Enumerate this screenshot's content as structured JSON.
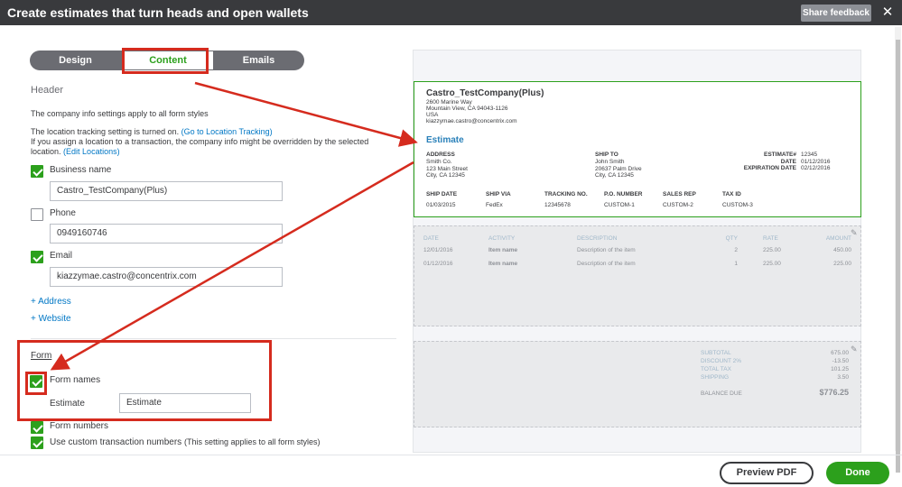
{
  "window": {
    "title": "Create estimates that turn heads and open wallets",
    "share_feedback": "Share feedback",
    "close_glyph": "✕"
  },
  "tabs": [
    "Design",
    "Content",
    "Emails"
  ],
  "header": {
    "title": "Header",
    "info1": "The company info settings apply to all form styles",
    "loc_line": "The location tracking setting is turned on.",
    "loc_link": "(Go to Location Tracking)",
    "override_line": "If you assign a location to a transaction, the company info might be overridden by the selected",
    "location_prefix": "location.",
    "edit_locations": "(Edit Locations)",
    "business_name_label": "Business name",
    "business_name_value": "Castro_TestCompany(Plus)",
    "phone_label": "Phone",
    "phone_value": "0949160746",
    "email_label": "Email",
    "email_value": "kiazzymae.castro@concentrix.com",
    "add_address": "+ Address",
    "add_website": "+ Website"
  },
  "form": {
    "title": "Form",
    "form_names_label": "Form names",
    "estimate_label": "Estimate",
    "estimate_value": "Estimate",
    "form_numbers_label": "Form numbers",
    "custom_numbers_label": "Use custom transaction numbers",
    "custom_numbers_note": "(This setting applies to all form styles)"
  },
  "checkboxes": {
    "business_name": true,
    "phone": false,
    "email": true,
    "form_names": true,
    "form_numbers": true,
    "custom_numbers": true
  },
  "preview": {
    "company": "Castro_TestCompany(Plus)",
    "addr1": "2600 Marine Way",
    "addr2": "Mountain View, CA 94043-1126",
    "country": "USA",
    "email": "kiazzymae.castro@concentrix.com",
    "doc_title": "Estimate",
    "address_label": "ADDRESS",
    "address_lines": [
      "Smith Co.",
      "123 Main Street",
      "City, CA 12345"
    ],
    "shipto_label": "SHIP TO",
    "shipto_lines": [
      "John Smith",
      "20637 Palm Drive",
      "City, CA 12345"
    ],
    "estimate_no_label": "ESTIMATE#",
    "estimate_no": "12345",
    "date_label": "DATE",
    "date": "01/12/2016",
    "expiration_label": "EXPIRATION DATE",
    "expiration": "02/12/2016",
    "ship_headers": [
      "SHIP DATE",
      "SHIP VIA",
      "TRACKING NO.",
      "P.O. NUMBER",
      "SALES REP",
      "TAX ID"
    ],
    "ship_values": [
      "01/03/2015",
      "FedEx",
      "12345678",
      "CUSTOM-1",
      "CUSTOM-2",
      "CUSTOM-3"
    ],
    "item_headers": [
      "DATE",
      "ACTIVITY",
      "DESCRIPTION",
      "QTY",
      "RATE",
      "AMOUNT"
    ],
    "items": [
      [
        "12/01/2016",
        "Item name",
        "Description of the item",
        "2",
        "225.00",
        "450.00"
      ],
      [
        "01/12/2016",
        "Item name",
        "Description of the item",
        "1",
        "225.00",
        "225.00"
      ]
    ],
    "totals": [
      [
        "SUBTOTAL",
        "675.00"
      ],
      [
        "DISCOUNT 2%",
        "-13.50"
      ],
      [
        "TOTAL TAX",
        "101.25"
      ],
      [
        "SHIPPING",
        "3.50"
      ]
    ],
    "balance_label": "BALANCE DUE",
    "balance": "$776.25"
  },
  "footer": {
    "preview_pdf": "Preview PDF",
    "done": "Done"
  },
  "colors": {
    "accent_green": "#2ca01c",
    "annotation_red": "#d52b1e",
    "link_blue": "#0077c5",
    "title_bar": "#393a3d"
  },
  "icons": [
    "close-icon",
    "checkbox-checked-icon",
    "checkbox-empty-icon",
    "pencil-icon"
  ]
}
